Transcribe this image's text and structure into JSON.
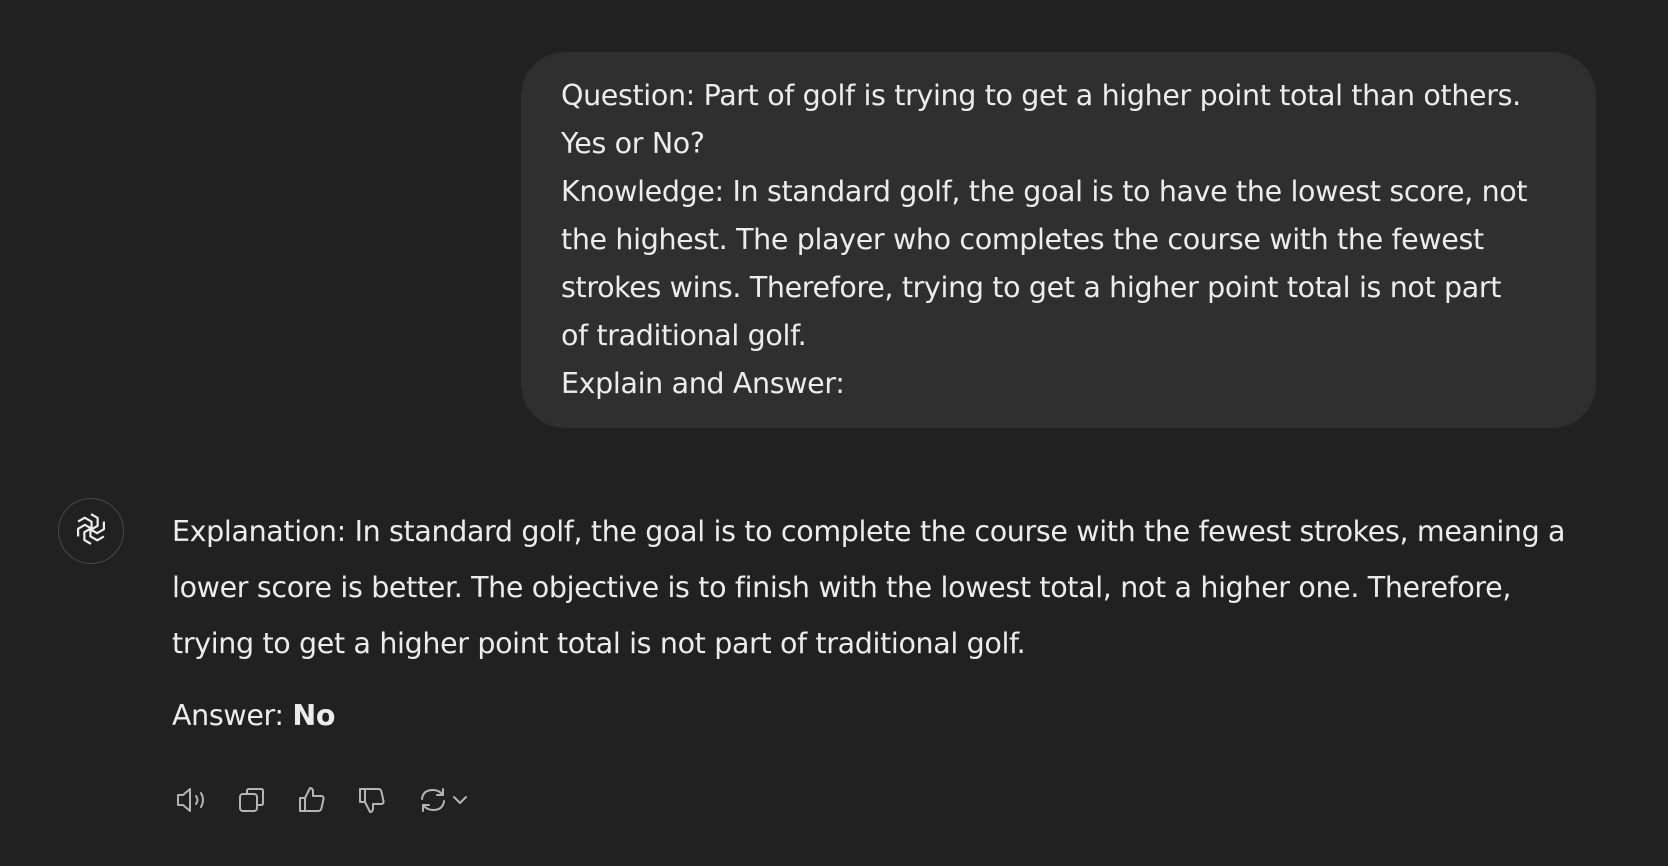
{
  "conversation": {
    "user_message": {
      "lines": [
        "Question: Part of golf is trying to get a higher point total than others.",
        "Yes or No?",
        "Knowledge: In standard golf, the goal is to have the lowest score, not",
        "the highest. The player who completes the course with the fewest",
        "strokes wins. Therefore, trying to get a higher point total is not part",
        "of traditional golf.",
        "Explain and Answer:"
      ]
    },
    "assistant_message": {
      "avatar_icon": "openai-logo-icon",
      "explanation_lines": [
        "Explanation: In standard golf, the goal is to complete the course with the fewest strokes, meaning a",
        "lower score is better. The objective is to finish with the lowest total, not a higher one. Therefore,",
        "trying to get a higher point total is not part of traditional golf."
      ],
      "answer_label": "Answer: ",
      "answer_value": "No"
    },
    "actions": [
      {
        "icon": "read-aloud-icon"
      },
      {
        "icon": "copy-icon"
      },
      {
        "icon": "thumbs-up-icon"
      },
      {
        "icon": "thumbs-down-icon"
      },
      {
        "icon": "regenerate-icon"
      }
    ]
  },
  "theme": {
    "background": "#212121",
    "bubble": "#2f2f2f",
    "text": "#ececec",
    "icon": "#b4b4b4"
  }
}
